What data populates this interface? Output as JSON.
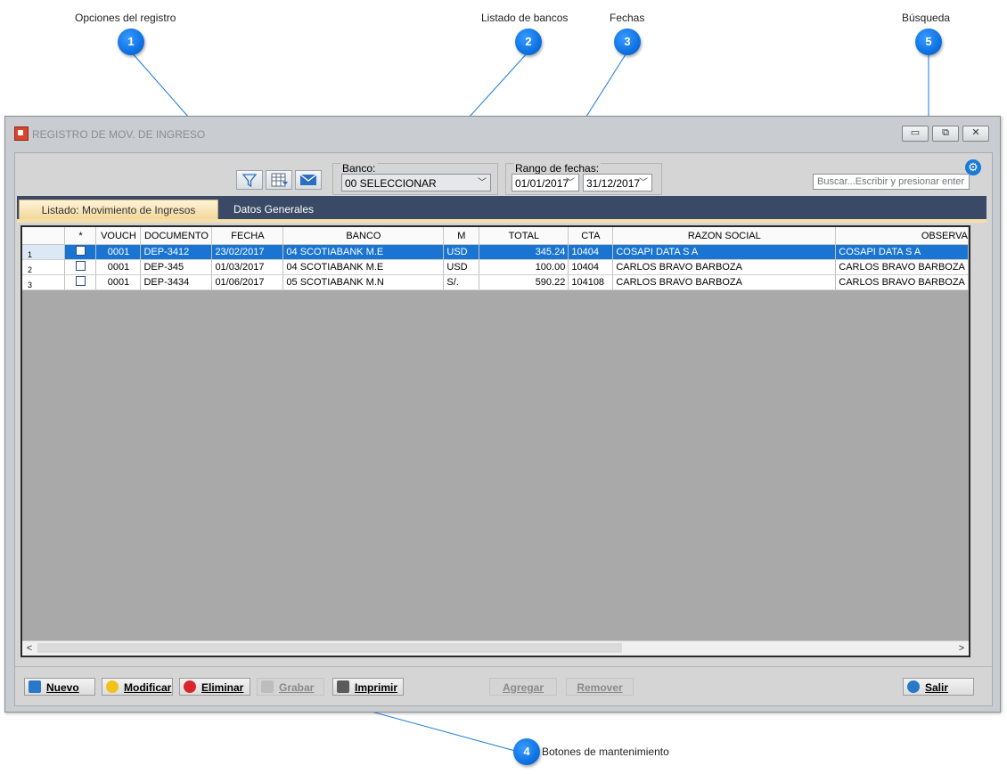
{
  "annotations": [
    {
      "number": "1",
      "label": "Opciones del registro"
    },
    {
      "number": "2",
      "label": "Listado de bancos"
    },
    {
      "number": "3",
      "label": "Fechas"
    },
    {
      "number": "4",
      "label": "Botones de mantenimiento"
    },
    {
      "number": "5",
      "label": "Búsqueda"
    }
  ],
  "window": {
    "title": "REGISTRO DE MOV. DE INGRESO",
    "minimize_icon": "minimize-icon",
    "restore_icon": "restore-icon",
    "close_icon": "close-icon"
  },
  "toolbar": {
    "icons": [
      "filter-icon",
      "grid-columns-icon",
      "email-icon"
    ],
    "banco_label": "Banco:",
    "banco_value": "00 SELECCIONAR",
    "rango_label": "Rango de fechas:",
    "fecha_desde": "01/01/2017",
    "fecha_hasta": "31/12/2017",
    "search_placeholder": "Buscar...Escribir y presionar enter",
    "settings_icon": "gear-icon"
  },
  "tabs": [
    {
      "label": "Listado: Movimiento de Ingresos",
      "active": true
    },
    {
      "label": "Datos Generales",
      "active": false
    }
  ],
  "grid": {
    "columns": [
      "",
      "*",
      "VOUCH",
      "DOCUMENTO",
      "FECHA",
      "BANCO",
      "M",
      "TOTAL",
      "CTA",
      "RAZON SOCIAL",
      "OBSERVA"
    ],
    "rows": [
      {
        "n": "1",
        "vouch": "0001",
        "documento": "DEP-3412",
        "fecha": "23/02/2017",
        "banco": "04 SCOTIABANK M.E",
        "m": "USD",
        "total": "345.24",
        "cta": "10404",
        "razon": "COSAPI DATA S A",
        "observa": "COSAPI DATA S A",
        "selected": true
      },
      {
        "n": "2",
        "vouch": "0001",
        "documento": "DEP-345",
        "fecha": "01/03/2017",
        "banco": "04 SCOTIABANK M.E",
        "m": "USD",
        "total": "100.00",
        "cta": "10404",
        "razon": "CARLOS BRAVO BARBOZA",
        "observa": "CARLOS  BRAVO BARBOZA",
        "selected": false
      },
      {
        "n": "3",
        "vouch": "0001",
        "documento": "DEP-3434",
        "fecha": "01/06/2017",
        "banco": "05 SCOTIABANK M.N",
        "m": "S/.",
        "total": "590.22",
        "cta": "104108",
        "razon": "CARLOS BRAVO BARBOZA",
        "observa": "CARLOS  BRAVO BARBOZA",
        "selected": false
      }
    ]
  },
  "buttons": {
    "nuevo": "Nuevo",
    "modificar": "Modificar",
    "eliminar": "Eliminar",
    "grabar": "Grabar",
    "imprimir": "Imprimir",
    "agregar": "Agregar",
    "remover": "Remover",
    "salir": "Salir"
  },
  "colors": {
    "badge": "#0a6fe0",
    "selection": "#1a75d2",
    "tabbar": "#3a4a66",
    "active_tab": "#f2d79a"
  }
}
